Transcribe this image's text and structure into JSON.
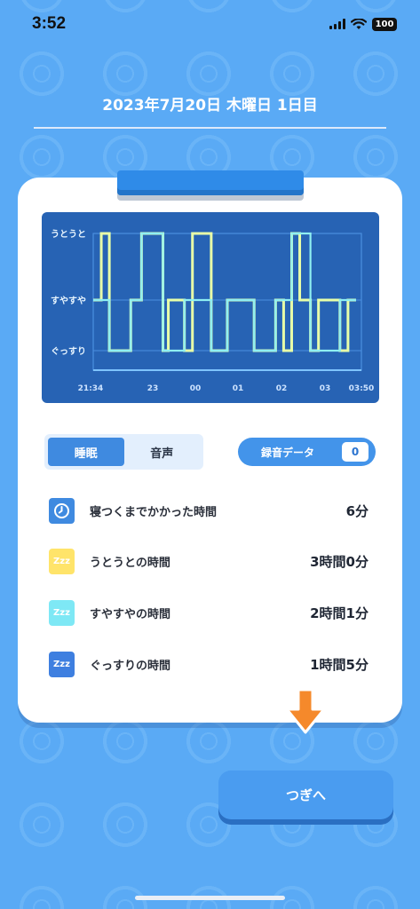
{
  "status": {
    "time": "3:52",
    "battery": "100"
  },
  "header": {
    "date_title": "2023年7月20日 木曜日 1日目"
  },
  "chart_data": {
    "type": "line",
    "y_categories": [
      "うとうと",
      "すやすや",
      "ぐっすり"
    ],
    "x_ticks": [
      "21:34",
      "23",
      "00",
      "01",
      "02",
      "03",
      "03:50"
    ],
    "series": [
      {
        "color": "#e8ffa8",
        "x": [
          0,
          0.03,
          0.03,
          0.06,
          0.06,
          0.14,
          0.14,
          0.18,
          0.18,
          0.26,
          0.26,
          0.28,
          0.28,
          0.34,
          0.34,
          0.37,
          0.37,
          0.44,
          0.44,
          0.5,
          0.5,
          0.6,
          0.6,
          0.68,
          0.68,
          0.71,
          0.71,
          0.74,
          0.74,
          0.77,
          0.77,
          0.81,
          0.81,
          0.84,
          0.84,
          0.92,
          0.92,
          0.95,
          0.95,
          0.98
        ],
        "y": [
          1,
          1,
          2,
          2,
          0,
          0,
          1,
          1,
          2,
          2,
          0,
          0,
          1,
          1,
          0,
          0,
          2,
          2,
          0,
          0,
          1,
          1,
          0,
          0,
          1,
          1,
          0,
          0,
          2,
          2,
          1,
          1,
          0,
          0,
          1,
          1,
          0,
          0,
          1,
          1
        ]
      },
      {
        "color": "#8ff0f2",
        "x": [
          0,
          0.06,
          0.14,
          0.18,
          0.26,
          0.34,
          0.44,
          0.5,
          0.6,
          0.68,
          0.74,
          0.81,
          0.92,
          0.98
        ],
        "y": [
          1,
          0,
          1,
          2,
          0,
          1,
          0,
          1,
          0,
          1,
          2,
          0,
          1,
          1
        ]
      }
    ]
  },
  "toggle": {
    "sleep_label": "睡眠",
    "sound_label": "音声"
  },
  "recording": {
    "label": "録音データ",
    "count": "0"
  },
  "stats": [
    {
      "icon": "clock-icon",
      "icon_text": "",
      "color": "#3f8ae0",
      "label": "寝つくまでかかった時間",
      "value": "6分"
    },
    {
      "icon": "zzz-light-icon",
      "icon_text": "Zzz",
      "color": "#ffe46a",
      "label": "うとうとの時間",
      "value": "3時間0分"
    },
    {
      "icon": "zzz-medium-icon",
      "icon_text": "Zzz",
      "color": "#7ee8f5",
      "label": "すやすやの時間",
      "value": "2時間1分"
    },
    {
      "icon": "zzz-deep-icon",
      "icon_text": "Zzz",
      "color": "#3e7fe0",
      "label": "ぐっすりの時間",
      "value": "1時間5分"
    }
  ],
  "next_button": {
    "label": "つぎへ"
  },
  "colors": {
    "background": "#5aaaf5",
    "accent": "#3f8ae0",
    "arrow": "#f5892b"
  }
}
